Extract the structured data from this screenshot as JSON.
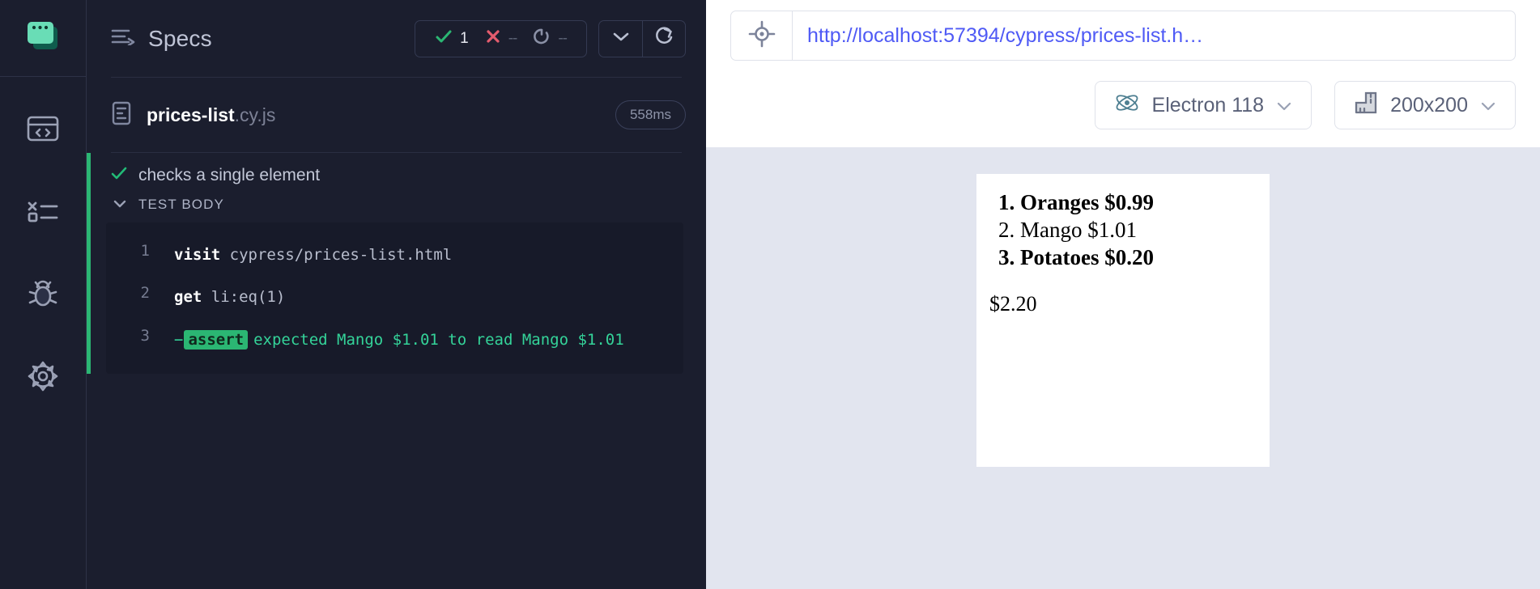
{
  "rail": {
    "logo_icon": "cypress-logo-icon",
    "items": [
      {
        "icon": "browser-code-icon",
        "name": "specs"
      },
      {
        "icon": "runs-list-icon",
        "name": "runs"
      },
      {
        "icon": "bug-debug-icon",
        "name": "debug"
      },
      {
        "icon": "gear-settings-icon",
        "name": "settings"
      }
    ]
  },
  "reporter": {
    "header": {
      "title": "Specs",
      "title_icon": "specs-list-icon",
      "stats": {
        "passed_icon": "check-icon",
        "passed": "1",
        "failed_icon": "x-icon",
        "failed": "--",
        "pending_icon": "pending-circle-icon",
        "pending": "--"
      },
      "collapse_icon": "chevron-down-icon",
      "reload_icon": "reload-icon"
    },
    "spec": {
      "file_icon": "spec-file-icon",
      "name": "prices-list",
      "ext": ".cy.js",
      "duration": "558ms"
    },
    "test": {
      "status_icon": "check-icon",
      "title": "checks a single element",
      "body_label": "TEST BODY",
      "body_toggle_icon": "chevron-down-icon",
      "commands": [
        {
          "num": "1",
          "name": "visit",
          "arg": "cypress/prices-list.html",
          "type": "command"
        },
        {
          "num": "2",
          "name": "get",
          "arg": "li:eq(1)",
          "type": "command"
        },
        {
          "num": "3",
          "dash": "−",
          "badge": "assert",
          "message": "expected Mango $1.01 to read Mango $1.01",
          "type": "assertion"
        }
      ]
    }
  },
  "aut": {
    "selector_icon": "selector-playground-icon",
    "url": "http://localhost:57394/cypress/prices-list.h…",
    "browser": {
      "icon": "electron-atom-icon",
      "label": "Electron 118",
      "chevron": "chevron-down-icon"
    },
    "viewport": {
      "icon": "ruler-icon",
      "label": "200x200",
      "chevron": "chevron-down-icon"
    },
    "page": {
      "items": [
        {
          "text": "Oranges $0.99",
          "bold": true
        },
        {
          "text": "Mango $1.01",
          "bold": false
        },
        {
          "text": "Potatoes $0.20",
          "bold": true
        }
      ],
      "total": "$2.20"
    }
  },
  "colors": {
    "accent_green": "#2bb673",
    "fail_red": "#e45c6e",
    "url_blue": "#4f5af5",
    "panel_dark": "#1b1e2e",
    "log_dark": "#171a29"
  }
}
